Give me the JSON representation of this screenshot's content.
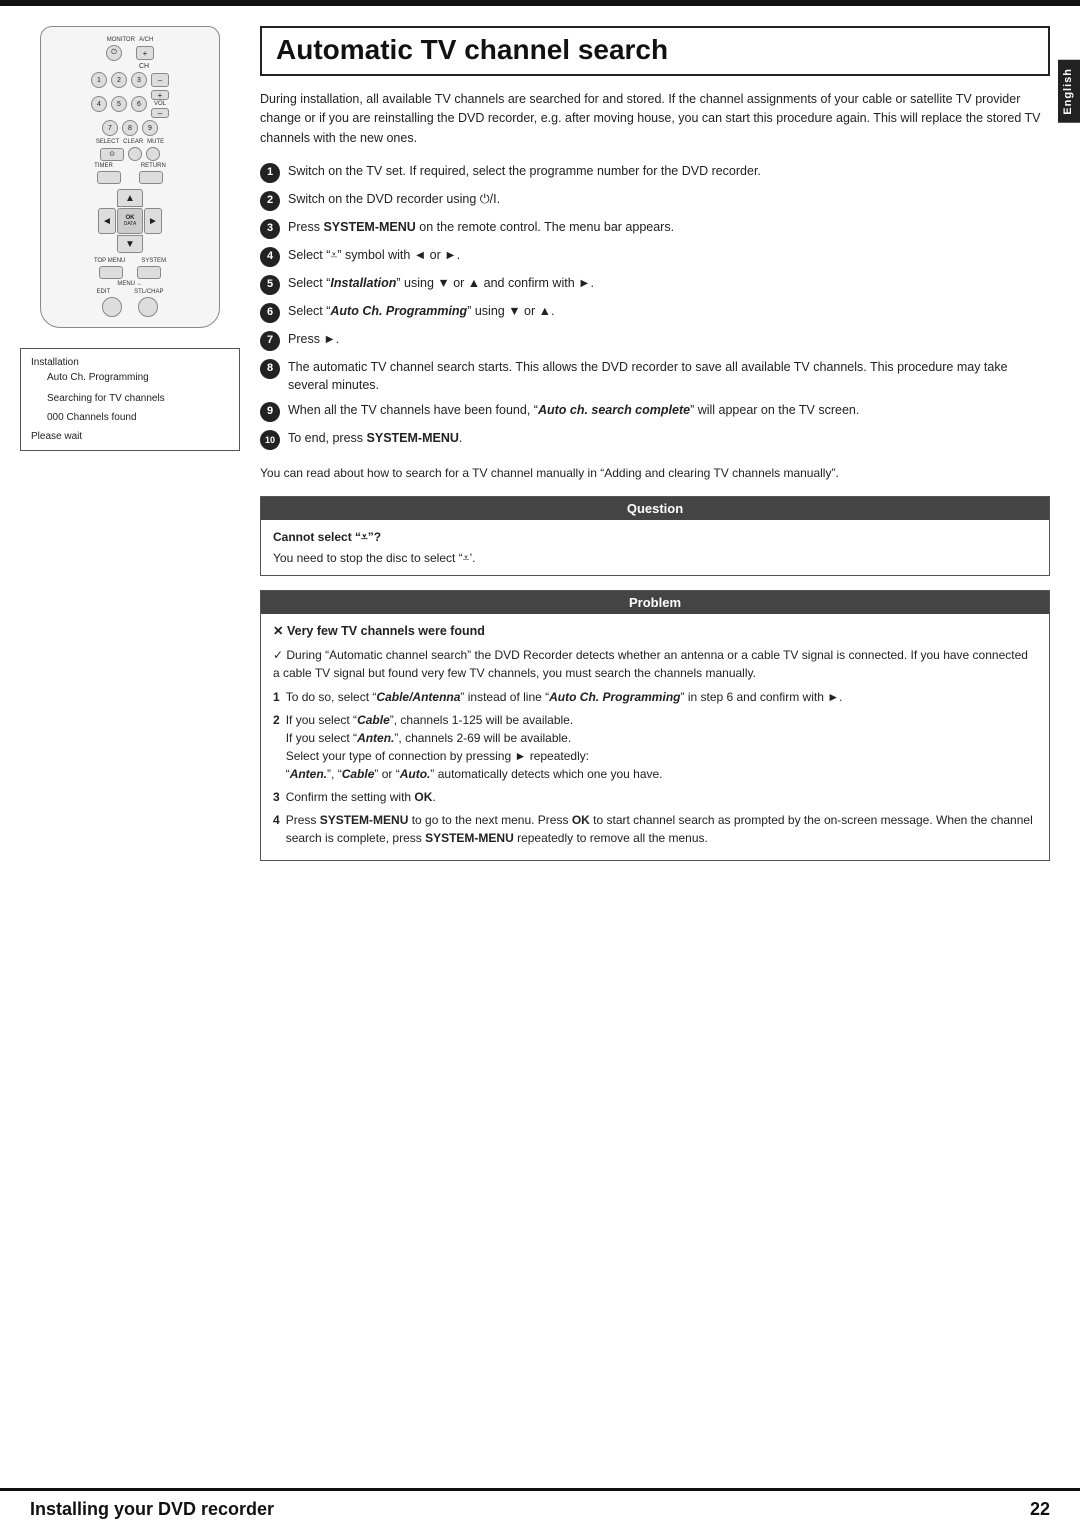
{
  "side_tab": "English",
  "page_title": "Automatic TV channel search",
  "intro": "During installation, all available TV channels are searched for and stored. If the channel assignments of your cable or satellite TV provider change or if you are reinstalling the DVD recorder, e.g. after moving house, you can start this procedure again. This will replace the stored TV channels with the new ones.",
  "steps": [
    {
      "num": "1",
      "text": "Switch on the TV set. If required, select the programme number for the DVD recorder."
    },
    {
      "num": "2",
      "text": "Switch on the DVD recorder using ⏻/I."
    },
    {
      "num": "3",
      "text_parts": [
        "Press ",
        "SYSTEM-MENU",
        " on the remote control. The menu bar appears."
      ]
    },
    {
      "num": "4",
      "text_parts": [
        "Select “⩡” symbol with ◄ or ►."
      ]
    },
    {
      "num": "5",
      "text_parts": [
        "Select “",
        "Installation",
        "” using ▼ or ▲ and confirm with ►."
      ]
    },
    {
      "num": "6",
      "text_parts": [
        "Select “",
        "Auto Ch. Programming",
        "” using ▼ or ▲."
      ]
    },
    {
      "num": "7",
      "text": "Press ►."
    },
    {
      "num": "8",
      "text": "The automatic TV channel search starts. This allows the DVD recorder to save all available TV channels. This procedure may take several minutes."
    },
    {
      "num": "9",
      "text_parts": [
        "When all the TV channels have been found, “",
        "Auto ch. search complete",
        "” will appear on the TV screen."
      ]
    },
    {
      "num": "10",
      "text_parts": [
        "To end, press ",
        "SYSTEM-MENU",
        "."
      ]
    }
  ],
  "footnote": "You can read about how to search for a TV channel manually in “Adding and clearing TV channels manually”.",
  "question": {
    "header": "Question",
    "q": "Cannot select “⩡”?",
    "a": "You need to stop the disc to select “⩡’."
  },
  "problem": {
    "header": "Problem",
    "title_x": "✕",
    "title_text": " Very few TV channels were found",
    "check_text": "✓ During “Automatic channel search” the DVD Recorder detects whether an antenna or a cable TV signal is connected. If you have connected a cable TV signal but found very few TV channels, you must search the channels manually.",
    "items": [
      {
        "num": "1",
        "text": "To do so, select “Cable/Antenna” instead of line “Auto Ch. Programming” in step 6 and confirm with ►."
      },
      {
        "num": "2",
        "text": "If you select “Cable”, channels 1-125 will be available.\nIf you select “Anten.”, channels 2-69 will be available.\nSelect your type of connection by pressing ► repeatedly:\n“Anten.”, “Cable” or “Auto.” automatically detects which one you have."
      },
      {
        "num": "3",
        "text": "Confirm the setting with OK."
      },
      {
        "num": "4",
        "text": "Press SYSTEM-MENU to go to the next menu. Press OK to start channel search as prompted by the on-screen message. When the channel search is complete, press SYSTEM-MENU repeatedly to remove all the menus."
      }
    ]
  },
  "screen": {
    "title": "Installation",
    "items": [
      "Auto Ch. Programming",
      "",
      "Searching for TV channels",
      "",
      "000 Channels found"
    ],
    "wait": "Please wait"
  },
  "bottom": {
    "title": "Installing your DVD recorder",
    "page_num": "22"
  }
}
